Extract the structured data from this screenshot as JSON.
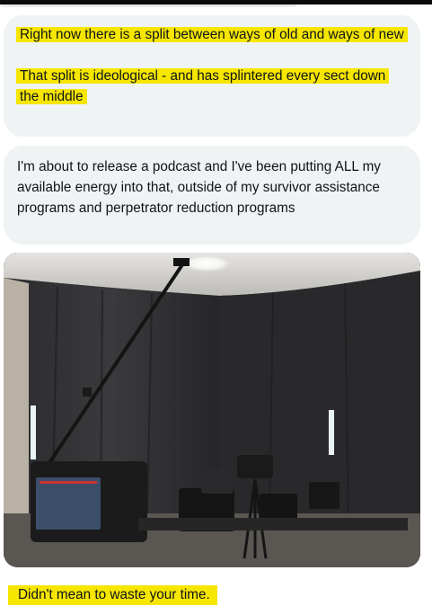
{
  "conversation": {
    "messages": [
      {
        "paragraphs": [
          "Right now there is a split between ways of old and ways of new",
          "That split is ideological - and has splintered every sect down the middle"
        ],
        "highlighted": true
      },
      {
        "paragraphs": [
          "I'm about to release a podcast and I've been putting ALL my available energy into that, outside of my survivor assistance programs and perpetrator reduction programs"
        ],
        "highlighted": false
      }
    ],
    "photo": {
      "type": "image-attachment",
      "subject": "podcast studio with black backdrop, boom microphone, cameras and monitors"
    },
    "last_message": "Didn't mean to waste your time."
  },
  "colors": {
    "bubble_background": "#eff3f4",
    "highlight": "#f6e600",
    "text": "#0f1419",
    "top_bar": "#0b0b0b"
  }
}
